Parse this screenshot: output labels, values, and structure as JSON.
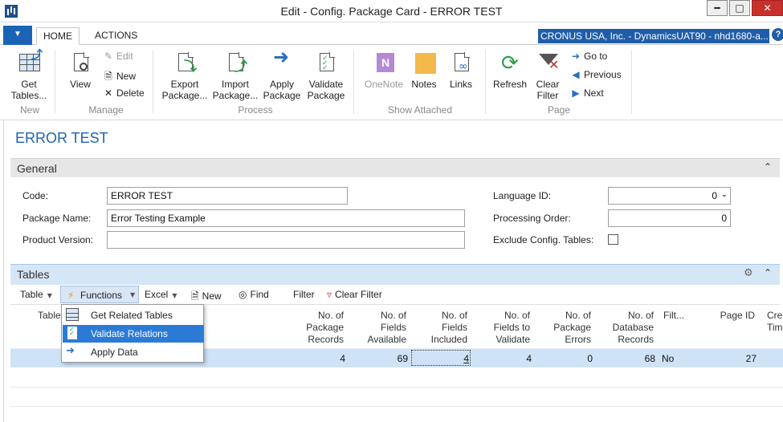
{
  "window": {
    "title": "Edit - Config. Package Card - ERROR TEST",
    "min_label": "━",
    "max_label": "□",
    "close_label": "✕"
  },
  "ribbon_tabs": {
    "home": "HOME",
    "actions": "ACTIONS",
    "company": "CRONUS USA, Inc. - DynamicsUAT90 - nhd1680-a...",
    "help": "?"
  },
  "ribbon": {
    "get_tables": "Get\nTables...",
    "view": "View",
    "edit": "Edit",
    "new": "New",
    "delete": "Delete",
    "export_package": "Export\nPackage...",
    "import_package": "Import\nPackage...",
    "apply_package": "Apply\nPackage",
    "validate_package": "Validate\nPackage",
    "onenote": "OneNote",
    "notes": "Notes",
    "links": "Links",
    "refresh": "Refresh",
    "clear_filter": "Clear\nFilter",
    "go_to": "Go to",
    "previous": "Previous",
    "next": "Next",
    "groups": {
      "new": "New",
      "manage": "Manage",
      "process": "Process",
      "show_attached": "Show Attached",
      "page": "Page"
    }
  },
  "page": {
    "title": "ERROR TEST"
  },
  "general": {
    "header": "General",
    "code_label": "Code:",
    "code_value": "ERROR TEST",
    "package_name_label": "Package Name:",
    "package_name_value": "Error Testing Example",
    "product_version_label": "Product Version:",
    "product_version_value": "",
    "language_id_label": "Language ID:",
    "language_id_value": "0",
    "processing_order_label": "Processing Order:",
    "processing_order_value": "0",
    "exclude_config_label": "Exclude Config. Tables:",
    "exclude_config_checked": false
  },
  "tables": {
    "header": "Tables",
    "toolbar": {
      "table": "Table",
      "functions": "Functions",
      "excel": "Excel",
      "new": "New",
      "find": "Find",
      "filter": "Filter",
      "clear_filter": "Clear Filter"
    },
    "columns": {
      "table": "Table",
      "package_records": "No. of\nPackage\nRecords",
      "fields_available": "No. of\nFields\nAvailable",
      "fields_included": "No. of\nFields\nIncluded",
      "fields_to_validate": "No. of\nFields to\nValidate",
      "package_errors": "No. of\nPackage\nErrors",
      "database_records": "No. of\nDatabase\nRecords",
      "filt": "Filt...",
      "page_id": "Page ID",
      "cre": "Cre\nTim"
    },
    "rows": [
      {
        "package_records": "4",
        "fields_available": "69",
        "fields_included": "4",
        "fields_to_validate": "4",
        "package_errors": "0",
        "database_records": "68",
        "filt": "No",
        "page_id": "27"
      }
    ]
  },
  "functions_menu": {
    "items": [
      {
        "label": "Get Related Tables",
        "icon": "get-related-tables-icon"
      },
      {
        "label": "Validate Relations",
        "icon": "validate-relations-icon"
      },
      {
        "label": "Apply Data",
        "icon": "apply-data-icon"
      }
    ],
    "selected_index": 1
  },
  "colors": {
    "accent": "#1f63b5",
    "selected_menu": "#2b7bd6",
    "row_highlight": "#cfe3f6"
  }
}
